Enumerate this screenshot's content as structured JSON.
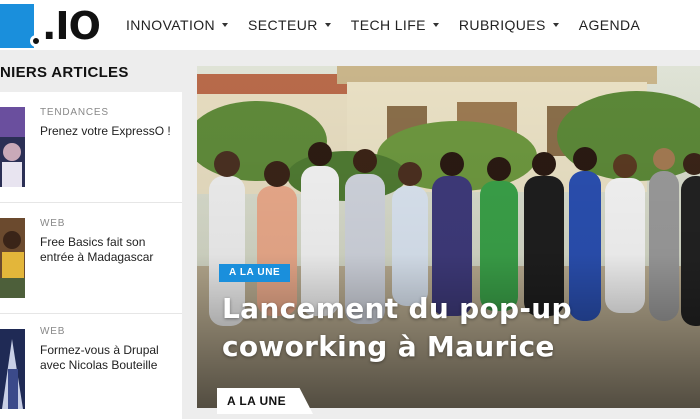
{
  "site": {
    "logo_text": ".IO"
  },
  "nav": [
    {
      "label": "INNOVATION",
      "has_dropdown": true
    },
    {
      "label": "SECTEUR",
      "has_dropdown": true
    },
    {
      "label": "TECH LIFE",
      "has_dropdown": true
    },
    {
      "label": "RUBRIQUES",
      "has_dropdown": true
    },
    {
      "label": "AGENDA",
      "has_dropdown": false
    }
  ],
  "sidebar": {
    "title": "NIERS ARTICLES",
    "articles": [
      {
        "category": "TENDANCES",
        "title": "Prenez votre ExpressO !"
      },
      {
        "category": "WEB",
        "title": "Free Basics fait son entrée à Madagascar"
      },
      {
        "category": "WEB",
        "title": "Formez-vous à Drupal avec Nicolas Bouteille"
      }
    ]
  },
  "hero": {
    "badge": "A LA UNE",
    "title": "Lancement du pop-up coworking à Maurice"
  },
  "bottom": {
    "tag": "A LA UNE"
  },
  "colors": {
    "accent": "#1a8fdc",
    "background": "#ededed"
  }
}
